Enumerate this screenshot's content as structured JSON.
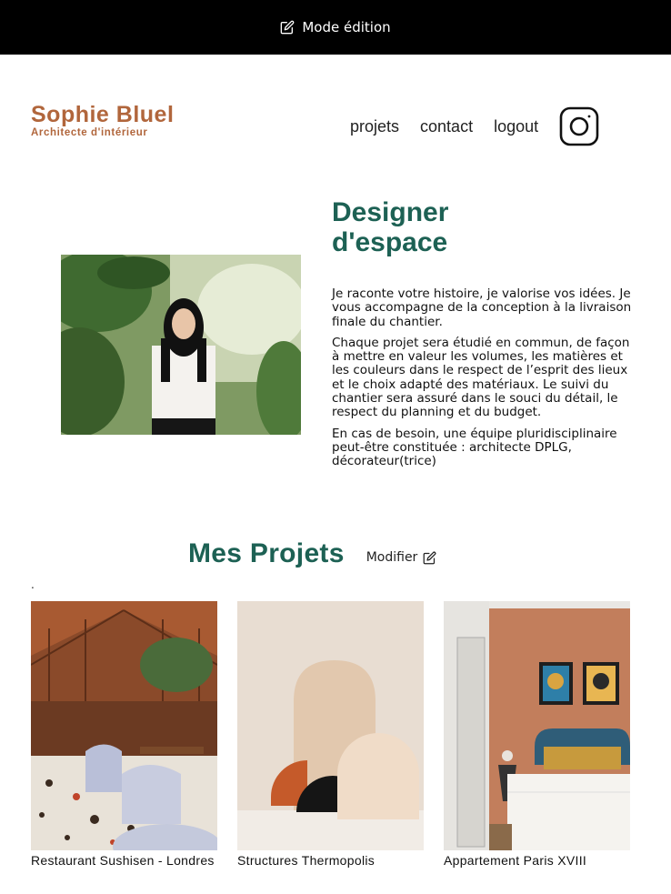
{
  "edit_bar": {
    "label": "Mode édition",
    "icon": "edit-icon"
  },
  "header": {
    "brand_name": "Sophie Bluel",
    "brand_subtitle": "Architecte d'intérieur",
    "nav": [
      "projets",
      "contact",
      "logout"
    ],
    "social_icon": "instagram-icon"
  },
  "intro": {
    "title": "Designer d'espace",
    "paragraphs": [
      "Je raconte votre histoire, je valorise vos idées. Je vous accompagne de la conception à la livraison finale du chantier.",
      "Chaque projet sera étudié en commun, de façon à mettre en valeur les volumes, les matières et les couleurs dans le respect de l’esprit des lieux et le choix adapté des matériaux. Le suivi du chantier sera assuré dans le souci du détail, le respect du planning et du budget.",
      "En cas de besoin, une équipe pluridisciplinaire peut-être constituée : architecte DPLG, décorateur(trice)"
    ]
  },
  "projects": {
    "title": "Mes Projets",
    "modify_label": "Modifier",
    "dot": ".",
    "items": [
      {
        "caption": "Restaurant Sushisen - Londres"
      },
      {
        "caption": "Structures Thermopolis"
      },
      {
        "caption": "Appartement Paris XVIII"
      }
    ]
  },
  "colors": {
    "brand": "#B1663C",
    "title_green": "#1D6154",
    "bar": "#000000"
  }
}
